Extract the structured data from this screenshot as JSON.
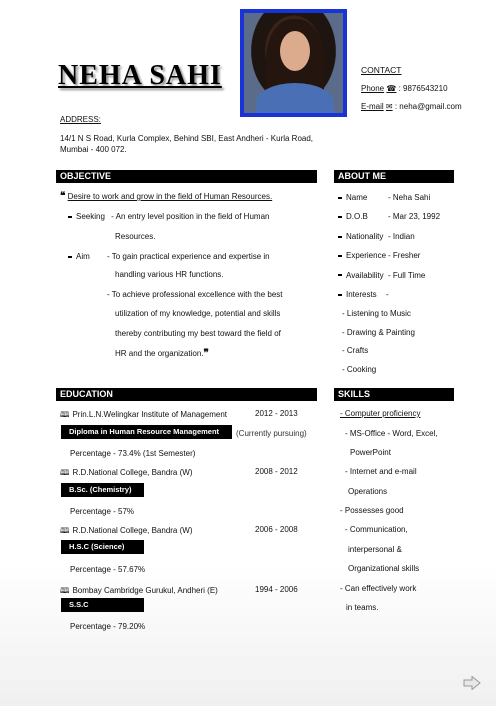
{
  "name": "NEHA SAHI",
  "contact": {
    "heading": "CONTACT",
    "phone_label": "Phone",
    "phone_icon": "☎",
    "phone_value": ": 9876543210",
    "email_label": "E-mail",
    "email_icon": "✉",
    "email_value": ": neha@gmail.com"
  },
  "address": {
    "heading": "ADDRESS:",
    "line1": "14/1 N S Road, Kurla Complex, Behind SBI, East Andheri - Kurla Road,",
    "line2": "Mumbai - 400 072."
  },
  "objective": {
    "heading": "OBJECTIVE",
    "intro": "Desire to work and grow in the field of Human Resources.",
    "seeking_label": "Seeking",
    "seeking_l1": "- An entry level position in the field of Human",
    "seeking_l2": "Resources.",
    "aim_label": "Aim",
    "aim_l1": "- To gain practical experience and expertise in",
    "aim_l2": "handling various HR functions.",
    "aim_l3": "- To achieve professional excellence with the best",
    "aim_l4": "utilization of my knowledge, potential and skills",
    "aim_l5": "thereby contributing my best toward the field of",
    "aim_l6": "HR and the organization."
  },
  "about": {
    "heading": "ABOUT ME",
    "rows": [
      {
        "k": "Name",
        "v": "- Neha Sahi"
      },
      {
        "k": "D.O.B",
        "v": "- Mar 23, 1992"
      },
      {
        "k": "Nationality",
        "v": "- Indian"
      },
      {
        "k": "Experience",
        "v": "- Fresher"
      },
      {
        "k": "Availability",
        "v": "- Full Time"
      },
      {
        "k": "Interests",
        "v": "-"
      }
    ],
    "interests": [
      "- Listening to Music",
      "- Drawing & Painting",
      "- Crafts",
      "- Cooking"
    ]
  },
  "education": {
    "heading": "EDUCATION",
    "items": [
      {
        "school": "Prin.L.N.Welingkar Institute of Management",
        "years": "2012 - 2013",
        "degree": "Diploma in Human Resource Management",
        "note": "(Currently pursuing)",
        "pct": "Percentage - 73.4% (1st Semester)"
      },
      {
        "school": "R.D.National College, Bandra (W)",
        "years": "2008 - 2012",
        "degree": "B.Sc. (Chemistry)",
        "note": "",
        "pct": "Percentage - 57%"
      },
      {
        "school": "R.D.National College, Bandra (W)",
        "years": "2006 - 2008",
        "degree": "H.S.C (Science)",
        "note": "",
        "pct": "Percentage - 57.67%"
      },
      {
        "school": "Bombay Cambridge Gurukul, Andheri (E)",
        "years": "1994 - 2006",
        "degree": "S.S.C",
        "note": "",
        "pct": "Percentage - 79.20%"
      }
    ]
  },
  "skills": {
    "heading": "SKILLS",
    "lines": [
      "- Computer proficiency",
      "- MS-Office - Word, Excel,",
      "PowerPoint",
      "- Internet and e-mail",
      "Operations",
      "- Possesses good",
      "- Communication,",
      "interpersonal &",
      "Organizational skills",
      "- Can effectively work",
      "in teams."
    ]
  }
}
